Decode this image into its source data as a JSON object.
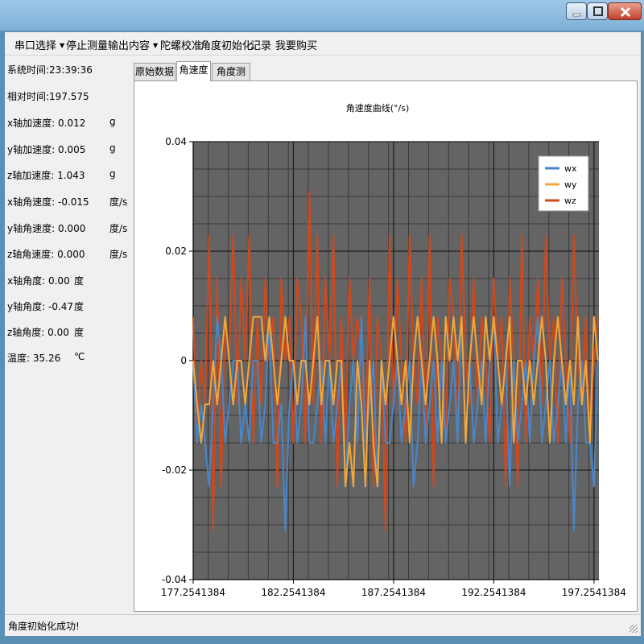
{
  "menu": {
    "items": [
      {
        "label": "串口选择",
        "dropdown": true
      },
      {
        "label": "停止测量",
        "dropdown": false
      },
      {
        "label": "输出内容",
        "dropdown": true
      },
      {
        "label": "陀螺校准",
        "dropdown": false
      },
      {
        "label": "角度初始化",
        "dropdown": false
      },
      {
        "label": "记录",
        "dropdown": false
      },
      {
        "label": "我要购买",
        "dropdown": false
      }
    ]
  },
  "info": [
    {
      "label": "系统时间:",
      "value": "23:39:36",
      "unit": ""
    },
    {
      "label": "相对时间:",
      "value": "197.575",
      "unit": ""
    },
    {
      "label": "x轴加速度:",
      "value": "0.012",
      "unit": "g"
    },
    {
      "label": "y轴加速度:",
      "value": "0.005",
      "unit": "g"
    },
    {
      "label": "z轴加速度:",
      "value": "1.043",
      "unit": "g"
    },
    {
      "label": "x轴角速度:",
      "value": "-0.015",
      "unit": "度/s"
    },
    {
      "label": "y轴角速度:",
      "value": "0.000",
      "unit": "度/s"
    },
    {
      "label": "z轴角速度:",
      "value": "0.000",
      "unit": "度/s"
    },
    {
      "label": "x轴角度:",
      "value": "0.00",
      "unit": "度"
    },
    {
      "label": "y轴角度:",
      "value": "-0.47",
      "unit": "度"
    },
    {
      "label": "z轴角度:",
      "value": "0.00",
      "unit": "度"
    },
    {
      "label": "温度:",
      "value": "35.26",
      "unit": "℃"
    }
  ],
  "tabs": [
    {
      "label": "原始数据",
      "active": false
    },
    {
      "label": "角速度",
      "active": true
    },
    {
      "label": "角度测量",
      "active": false
    }
  ],
  "status": {
    "text": "角度初始化成功!"
  },
  "icons": {
    "minimize": "minimize-icon",
    "maximize": "maximize-icon",
    "close": "close-icon",
    "dropdown": "dropdown-arrow-icon"
  },
  "colors": {
    "plot_bg": "#646464",
    "wx": "#4a86c8",
    "wy": "#f2a83c",
    "wz": "#d0481c"
  },
  "chart_data": {
    "type": "line",
    "title": "角速度曲线(°/s)",
    "xlim": [
      177.2541384,
      197.5
    ],
    "ylim": [
      -0.04,
      0.04
    ],
    "x_ticks": [
      177.2541384,
      182.2541384,
      187.2541384,
      192.2541384,
      197.2541384
    ],
    "x_tick_labels": [
      "177.2541384",
      "182.2541384",
      "187.2541384",
      "192.2541384",
      "197.2541384"
    ],
    "y_ticks": [
      0.04,
      0.02,
      0,
      -0.02,
      -0.04
    ],
    "y_tick_labels": [
      "0.04",
      "0.02",
      "0",
      "-0.02",
      "-0.04"
    ],
    "grid": true,
    "legend": "top-right",
    "series": [
      {
        "name": "wx",
        "x": [
          177.25,
          177.45,
          177.65,
          177.85,
          178.05,
          178.25,
          178.45,
          178.65,
          178.85,
          179.05,
          179.25,
          179.45,
          179.65,
          179.85,
          180.05,
          180.25,
          180.45,
          180.65,
          180.85,
          181.05,
          181.25,
          181.45,
          181.65,
          181.85,
          182.05,
          182.25,
          182.45,
          182.65,
          182.85,
          183.05,
          183.25,
          183.45,
          183.65,
          183.85,
          184.05,
          184.25,
          184.45,
          184.65,
          184.85,
          185.05,
          185.25,
          185.45,
          185.65,
          185.85,
          186.05,
          186.25,
          186.45,
          186.65,
          186.85,
          187.05,
          187.25,
          187.45,
          187.65,
          187.85,
          188.05,
          188.25,
          188.45,
          188.65,
          188.85,
          189.05,
          189.25,
          189.45,
          189.65,
          189.85,
          190.05,
          190.25,
          190.45,
          190.65,
          190.85,
          191.05,
          191.25,
          191.45,
          191.65,
          191.85,
          192.05,
          192.25,
          192.45,
          192.65,
          192.85,
          193.05,
          193.25,
          193.45,
          193.65,
          193.85,
          194.05,
          194.25,
          194.45,
          194.65,
          194.85,
          195.05,
          195.25,
          195.45,
          195.65,
          195.85,
          196.05,
          196.25,
          196.45,
          196.65,
          196.85,
          197.05,
          197.25,
          197.45
        ],
        "values": [
          0,
          -0.015,
          -0.008,
          -0.015,
          -0.023,
          -0.008,
          0.008,
          0,
          -0.015,
          -0.008,
          0,
          0,
          -0.015,
          -0.008,
          -0.015,
          0,
          0,
          -0.015,
          -0.008,
          0.008,
          -0.015,
          -0.015,
          -0.008,
          -0.031,
          -0.008,
          0,
          -0.015,
          -0.008,
          0.008,
          -0.015,
          -0.015,
          -0.008,
          0,
          -0.015,
          0,
          -0.015,
          -0.008,
          0,
          -0.023,
          -0.008,
          0,
          -0.015,
          0.008,
          -0.015,
          -0.008,
          0,
          -0.023,
          0,
          -0.015,
          -0.015,
          -0.008,
          0,
          -0.015,
          -0.008,
          0,
          -0.023,
          -0.015,
          0,
          -0.015,
          -0.008,
          0,
          -0.015,
          0,
          -0.015,
          -0.008,
          0,
          -0.015,
          0.008,
          -0.015,
          0,
          -0.015,
          -0.008,
          0,
          -0.015,
          0,
          0.008,
          -0.015,
          -0.008,
          0,
          -0.023,
          0,
          -0.015,
          -0.008,
          0,
          -0.015,
          0,
          0.008,
          -0.015,
          -0.008,
          0,
          -0.015,
          -0.008,
          0,
          -0.015,
          0,
          -0.031,
          -0.008,
          0,
          -0.015,
          -0.015,
          -0.023,
          0
        ]
      },
      {
        "name": "wy",
        "x": [
          177.25,
          177.45,
          177.65,
          177.85,
          178.05,
          178.25,
          178.45,
          178.65,
          178.85,
          179.05,
          179.25,
          179.45,
          179.65,
          179.85,
          180.05,
          180.25,
          180.45,
          180.65,
          180.85,
          181.05,
          181.25,
          181.45,
          181.65,
          181.85,
          182.05,
          182.25,
          182.45,
          182.65,
          182.85,
          183.05,
          183.25,
          183.45,
          183.65,
          183.85,
          184.05,
          184.25,
          184.45,
          184.65,
          184.85,
          185.05,
          185.25,
          185.45,
          185.65,
          185.85,
          186.05,
          186.25,
          186.45,
          186.65,
          186.85,
          187.05,
          187.25,
          187.45,
          187.65,
          187.85,
          188.05,
          188.25,
          188.45,
          188.65,
          188.85,
          189.05,
          189.25,
          189.45,
          189.65,
          189.85,
          190.05,
          190.25,
          190.45,
          190.65,
          190.85,
          191.05,
          191.25,
          191.45,
          191.65,
          191.85,
          192.05,
          192.25,
          192.45,
          192.65,
          192.85,
          193.05,
          193.25,
          193.45,
          193.65,
          193.85,
          194.05,
          194.25,
          194.45,
          194.65,
          194.85,
          195.05,
          195.25,
          195.45,
          195.65,
          195.85,
          196.05,
          196.25,
          196.45,
          196.65,
          196.85,
          197.05,
          197.25,
          197.45
        ],
        "values": [
          0,
          -0.008,
          -0.015,
          -0.008,
          -0.008,
          0,
          -0.008,
          0,
          0.008,
          0,
          -0.008,
          0,
          0,
          -0.008,
          0,
          0.008,
          0.008,
          0.008,
          0,
          0.008,
          0,
          -0.008,
          0,
          0.008,
          0,
          0,
          -0.008,
          0,
          0,
          -0.008,
          0,
          0.008,
          -0.008,
          0,
          0,
          -0.008,
          0,
          0,
          -0.023,
          -0.015,
          -0.023,
          0,
          -0.008,
          -0.023,
          0,
          -0.015,
          -0.023,
          0,
          -0.008,
          0,
          0.008,
          0,
          -0.008,
          0,
          -0.015,
          0,
          0.008,
          0,
          -0.008,
          0,
          0.008,
          0,
          -0.015,
          0.008,
          0,
          0.008,
          0,
          0.008,
          -0.015,
          0,
          0.008,
          0,
          -0.008,
          0.008,
          0,
          0.008,
          0,
          -0.008,
          0,
          0.008,
          -0.015,
          0,
          0,
          -0.008,
          0,
          -0.008,
          0,
          0.008,
          0,
          -0.015,
          0,
          0.008,
          0,
          -0.008,
          0,
          -0.008,
          0.008,
          -0.008,
          0,
          -0.015,
          0.008,
          0
        ]
      },
      {
        "name": "wz",
        "x": [
          177.25,
          177.45,
          177.65,
          177.85,
          178.05,
          178.25,
          178.45,
          178.65,
          178.85,
          179.05,
          179.25,
          179.45,
          179.65,
          179.85,
          180.05,
          180.25,
          180.45,
          180.65,
          180.85,
          181.05,
          181.25,
          181.45,
          181.65,
          181.85,
          182.05,
          182.25,
          182.45,
          182.65,
          182.85,
          183.05,
          183.25,
          183.45,
          183.65,
          183.85,
          184.05,
          184.25,
          184.45,
          184.65,
          184.85,
          185.05,
          185.25,
          185.45,
          185.65,
          185.85,
          186.05,
          186.25,
          186.45,
          186.65,
          186.85,
          187.05,
          187.25,
          187.45,
          187.65,
          187.85,
          188.05,
          188.25,
          188.45,
          188.65,
          188.85,
          189.05,
          189.25,
          189.45,
          189.65,
          189.85,
          190.05,
          190.25,
          190.45,
          190.65,
          190.85,
          191.05,
          191.25,
          191.45,
          191.65,
          191.85,
          192.05,
          192.25,
          192.45,
          192.65,
          192.85,
          193.05,
          193.25,
          193.45,
          193.65,
          193.85,
          194.05,
          194.25,
          194.45,
          194.65,
          194.85,
          195.05,
          195.25,
          195.45,
          195.65,
          195.85,
          196.05,
          196.25,
          196.45,
          196.65,
          196.85,
          197.05,
          197.25,
          197.45
        ],
        "values": [
          0.008,
          -0.015,
          0,
          -0.008,
          0.023,
          -0.031,
          0.015,
          -0.023,
          0.008,
          0,
          0.023,
          -0.008,
          0.015,
          0,
          0.023,
          -0.015,
          0.008,
          -0.008,
          0.015,
          0,
          0.008,
          -0.023,
          0.015,
          0,
          0.008,
          -0.015,
          0.015,
          0.008,
          -0.015,
          0.031,
          -0.008,
          0.023,
          -0.015,
          0.015,
          0,
          0.023,
          -0.023,
          0.008,
          -0.015,
          0.015,
          0,
          0.008,
          0,
          -0.015,
          0.015,
          -0.023,
          0.008,
          0,
          -0.031,
          0.023,
          -0.008,
          0.015,
          0,
          -0.015,
          0.023,
          0,
          -0.008,
          0.015,
          -0.015,
          0.023,
          -0.023,
          0.008,
          0,
          -0.015,
          0.015,
          0.008,
          -0.015,
          0.023,
          0,
          -0.008,
          0.015,
          -0.008,
          0.008,
          0,
          -0.015,
          0.015,
          0,
          0.008,
          -0.023,
          0.015,
          0,
          -0.023,
          0.023,
          -0.015,
          0.008,
          0,
          0.015,
          -0.008,
          0.023,
          0,
          0.008,
          -0.015,
          0.015,
          0,
          -0.015,
          0.023,
          0,
          -0.008,
          0.008,
          -0.015,
          0,
          0.008
        ]
      }
    ]
  }
}
